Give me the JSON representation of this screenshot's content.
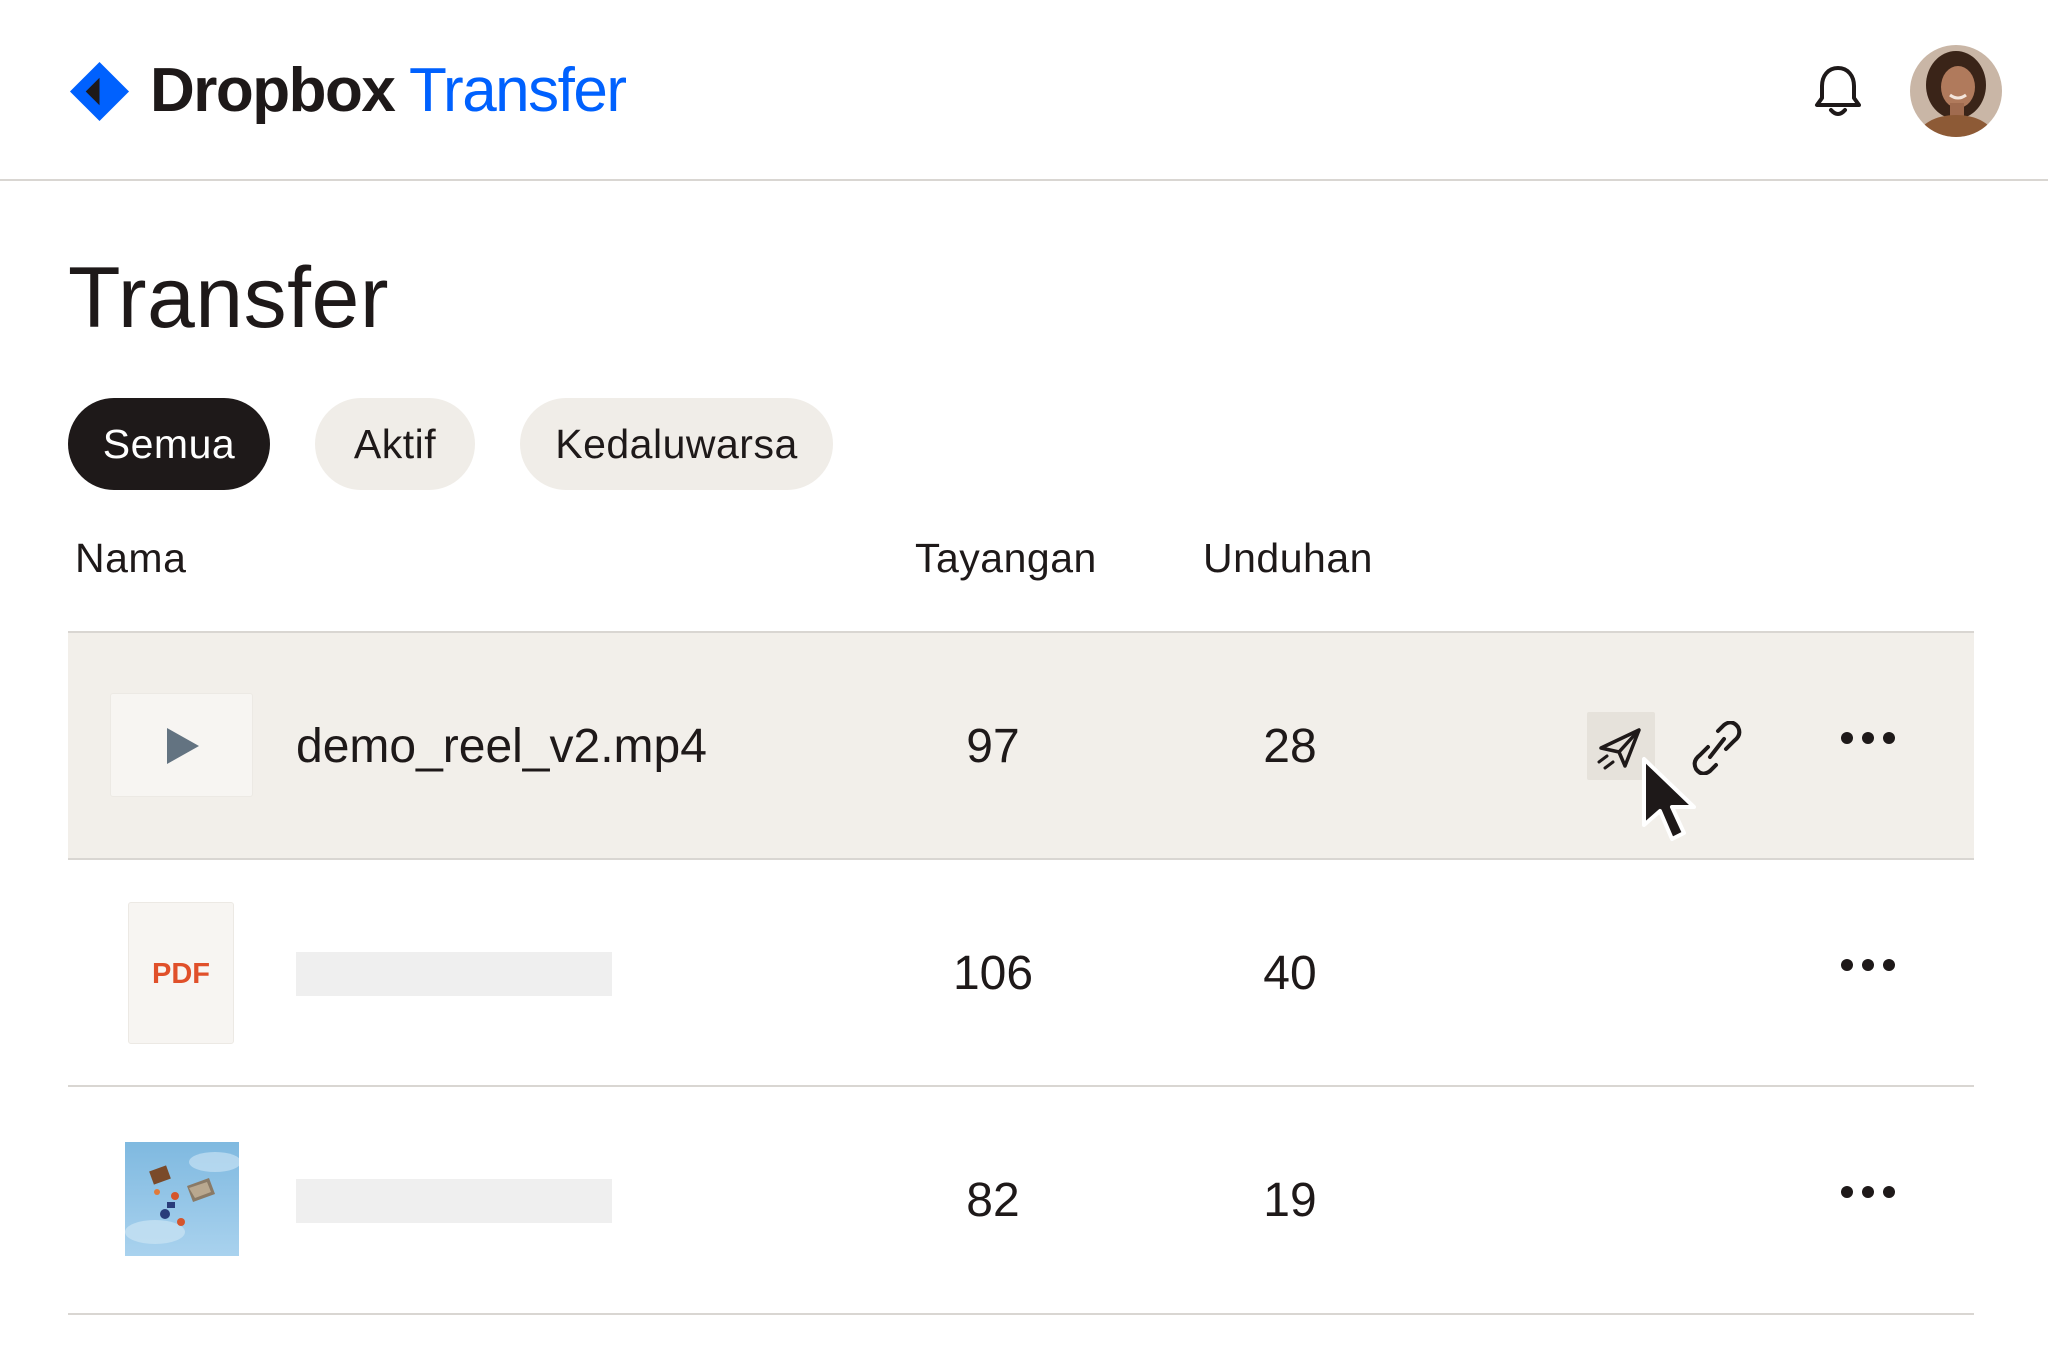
{
  "app": {
    "logo_word": "Dropbox",
    "logo_product": "Transfer",
    "brand_color": "#0061fe"
  },
  "header": {
    "notification_icon": "bell-icon",
    "avatar_icon": "user-avatar"
  },
  "page": {
    "title": "Transfer"
  },
  "filters": [
    {
      "label": "Semua",
      "active": true
    },
    {
      "label": "Aktif",
      "active": false
    },
    {
      "label": "Kedaluwarsa",
      "active": false
    }
  ],
  "table": {
    "columns": {
      "name": "Nama",
      "views": "Tayangan",
      "downloads": "Unduhan"
    },
    "rows": [
      {
        "name": "demo_reel_v2.mp4",
        "thumb": "video-play-icon",
        "views": "97",
        "downloads": "28",
        "hovered": true
      },
      {
        "name": "",
        "thumb_label": "PDF",
        "views": "106",
        "downloads": "40",
        "hovered": false
      },
      {
        "name": "",
        "thumb": "image-thumbnail",
        "views": "82",
        "downloads": "19",
        "hovered": false
      }
    ],
    "row_actions": [
      "send-icon",
      "link-icon",
      "more-icon"
    ]
  }
}
